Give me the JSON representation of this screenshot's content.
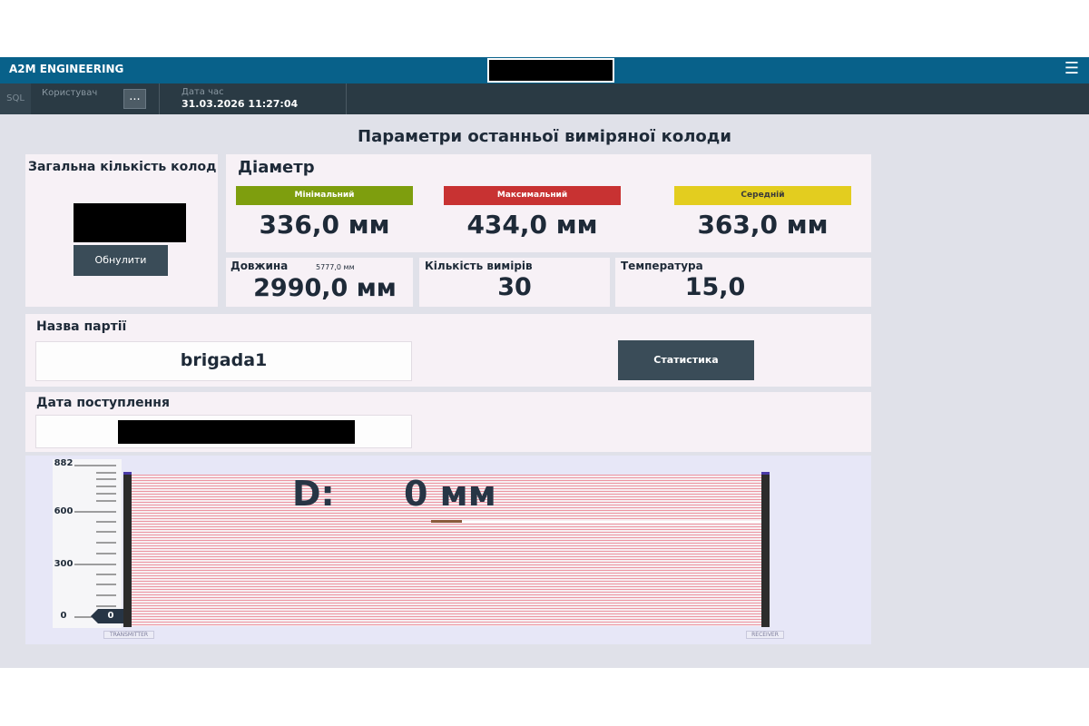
{
  "header": {
    "brand": "A2M ENGINEERING",
    "menu_icon": "hamburger-menu-icon",
    "accent_color": "#08618a"
  },
  "infobar": {
    "sql": "SQL",
    "user_label": "Користувач",
    "more_label": "...",
    "datetime_label": "Дата час",
    "datetime_value": "31.03.2026 11:27:04"
  },
  "page": {
    "title": "Параметри останньої виміряної колоди"
  },
  "total": {
    "label": "Загальна кількість колод",
    "reset_label": "Обнулити"
  },
  "diameter": {
    "label": "Діаметр",
    "min": {
      "label": "Мінімальний",
      "value": "336,0 мм",
      "color": "#7e9e0e"
    },
    "max": {
      "label": "Максимальний",
      "value": "434,0 мм",
      "color": "#c83232"
    },
    "avg": {
      "label": "Середній",
      "value": "363,0 мм",
      "color": "#e3cd1f"
    }
  },
  "length": {
    "label": "Довжина",
    "secondary": "5777,0 мм",
    "value": "2990,0 мм"
  },
  "measurements": {
    "label": "Кількість вимірів",
    "value": "30"
  },
  "temperature": {
    "label": "Температура",
    "value": "15,0"
  },
  "batch": {
    "label": "Назва партії",
    "value": "brigada1",
    "stats_label": "Статистика"
  },
  "arrival": {
    "label": "Дата поступлення"
  },
  "gauge": {
    "d_label": "D:",
    "d_value": "0 мм",
    "scale_max": "882",
    "scale_600": "600",
    "scale_300": "300",
    "scale_0": "0",
    "pointer_value": "0",
    "transmitter": "TRANSMITTER",
    "receiver": "RECEIVER",
    "beam_color": "#ec95a2"
  }
}
